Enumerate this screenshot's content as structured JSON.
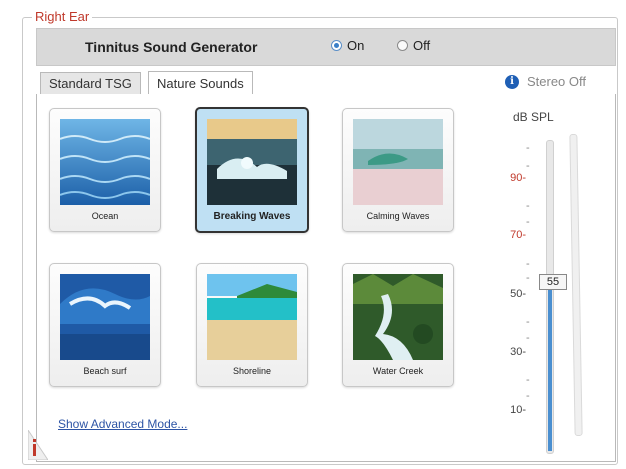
{
  "group": {
    "title": "Right Ear"
  },
  "header": {
    "title": "Tinnitus Sound Generator",
    "radio_on": "On",
    "radio_off": "Off",
    "selected": "On"
  },
  "tabs": [
    {
      "label": "Standard TSG",
      "active": false
    },
    {
      "label": "Nature Sounds",
      "active": true
    }
  ],
  "stereo": {
    "icon": "info-icon",
    "label": "Stereo Off"
  },
  "sounds": [
    {
      "label": "Ocean",
      "selected": false
    },
    {
      "label": "Breaking Waves",
      "selected": true
    },
    {
      "label": "Calming Waves",
      "selected": false
    },
    {
      "label": "Beach surf",
      "selected": false
    },
    {
      "label": "Shoreline",
      "selected": false
    },
    {
      "label": "Water Creek",
      "selected": false
    }
  ],
  "advanced_link": "Show Advanced Mode...",
  "level": {
    "title": "dB SPL",
    "ticks": [
      "90-",
      "70-",
      "50-",
      "30-",
      "10-"
    ],
    "value": "55"
  },
  "colors": {
    "accent": "#4a8fd0",
    "legend": "#c0392b",
    "link": "#2d54a5"
  }
}
